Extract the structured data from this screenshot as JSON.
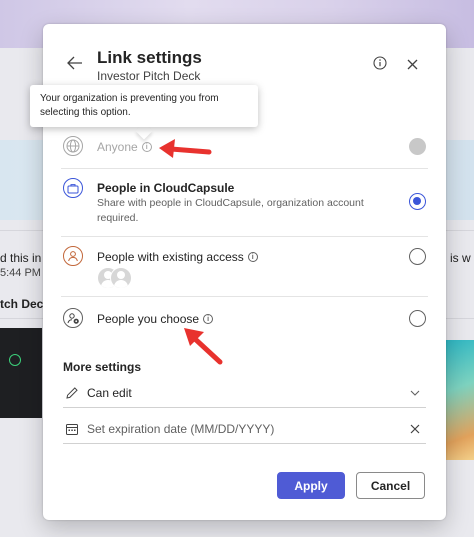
{
  "background": {
    "fragment_1": "d this in",
    "fragment_2": "5:44 PM",
    "fragment_3": "tch Deck",
    "fragment_4": "is w"
  },
  "dialog": {
    "title": "Link settings",
    "subtitle": "Investor Pitch Deck",
    "tooltip": "Your organization is preventing you from selecting this option.",
    "options": [
      {
        "title": "Anyone",
        "description": "",
        "state": "disabled",
        "icon": "globe-icon"
      },
      {
        "title": "People in CloudCapsule",
        "description": "Share with people in CloudCapsule, organization account required.",
        "state": "checked",
        "icon": "briefcase-icon"
      },
      {
        "title": "People with existing access",
        "description": "",
        "state": "unchecked",
        "icon": "person-icon"
      },
      {
        "title": "People you choose",
        "description": "",
        "state": "unchecked",
        "icon": "people-settings-icon"
      }
    ],
    "more_settings": {
      "heading": "More settings",
      "permission": "Can edit",
      "expiration_placeholder": "Set expiration date (MM/DD/YYYY)"
    },
    "apply_label": "Apply",
    "cancel_label": "Cancel"
  },
  "colors": {
    "accent": "#4f5bd5",
    "radio_selected": "#3b56d9",
    "annotation_arrow": "#e8322e"
  }
}
